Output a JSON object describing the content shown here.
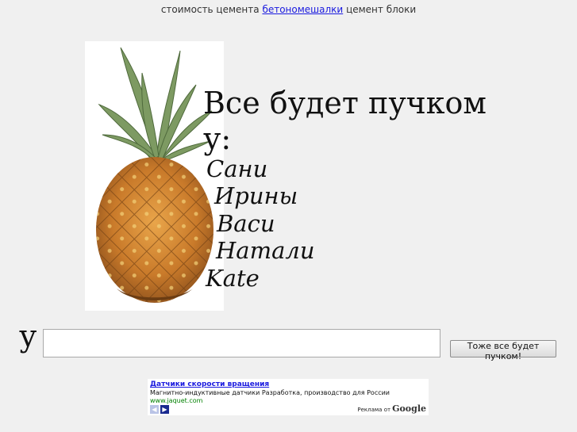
{
  "topbar": {
    "prefix": "стоимость цемента",
    "link": "бетономешалки",
    "suffix": "цемент блоки"
  },
  "headline": {
    "line1": "Все будет пучком",
    "line2": "у:"
  },
  "names": [
    "Сани",
    "Ирины",
    "Васи",
    "Натали",
    "Kate"
  ],
  "form": {
    "prefix": "у",
    "input_value": "",
    "submit_label": "Тоже все будет пучком!"
  },
  "ad": {
    "title": "Датчики скорости вращения",
    "description": "Магнитно-индуктивные датчики Разработка, производство для России",
    "url": "www.jaquet.com",
    "by_label": "Реклама от",
    "brand": "Google",
    "prev_icon": "chevron-left-icon",
    "next_icon": "chevron-right-icon"
  },
  "colors": {
    "link": "#1a1adf",
    "ad_url": "#008000",
    "background": "#f0f0f0"
  }
}
